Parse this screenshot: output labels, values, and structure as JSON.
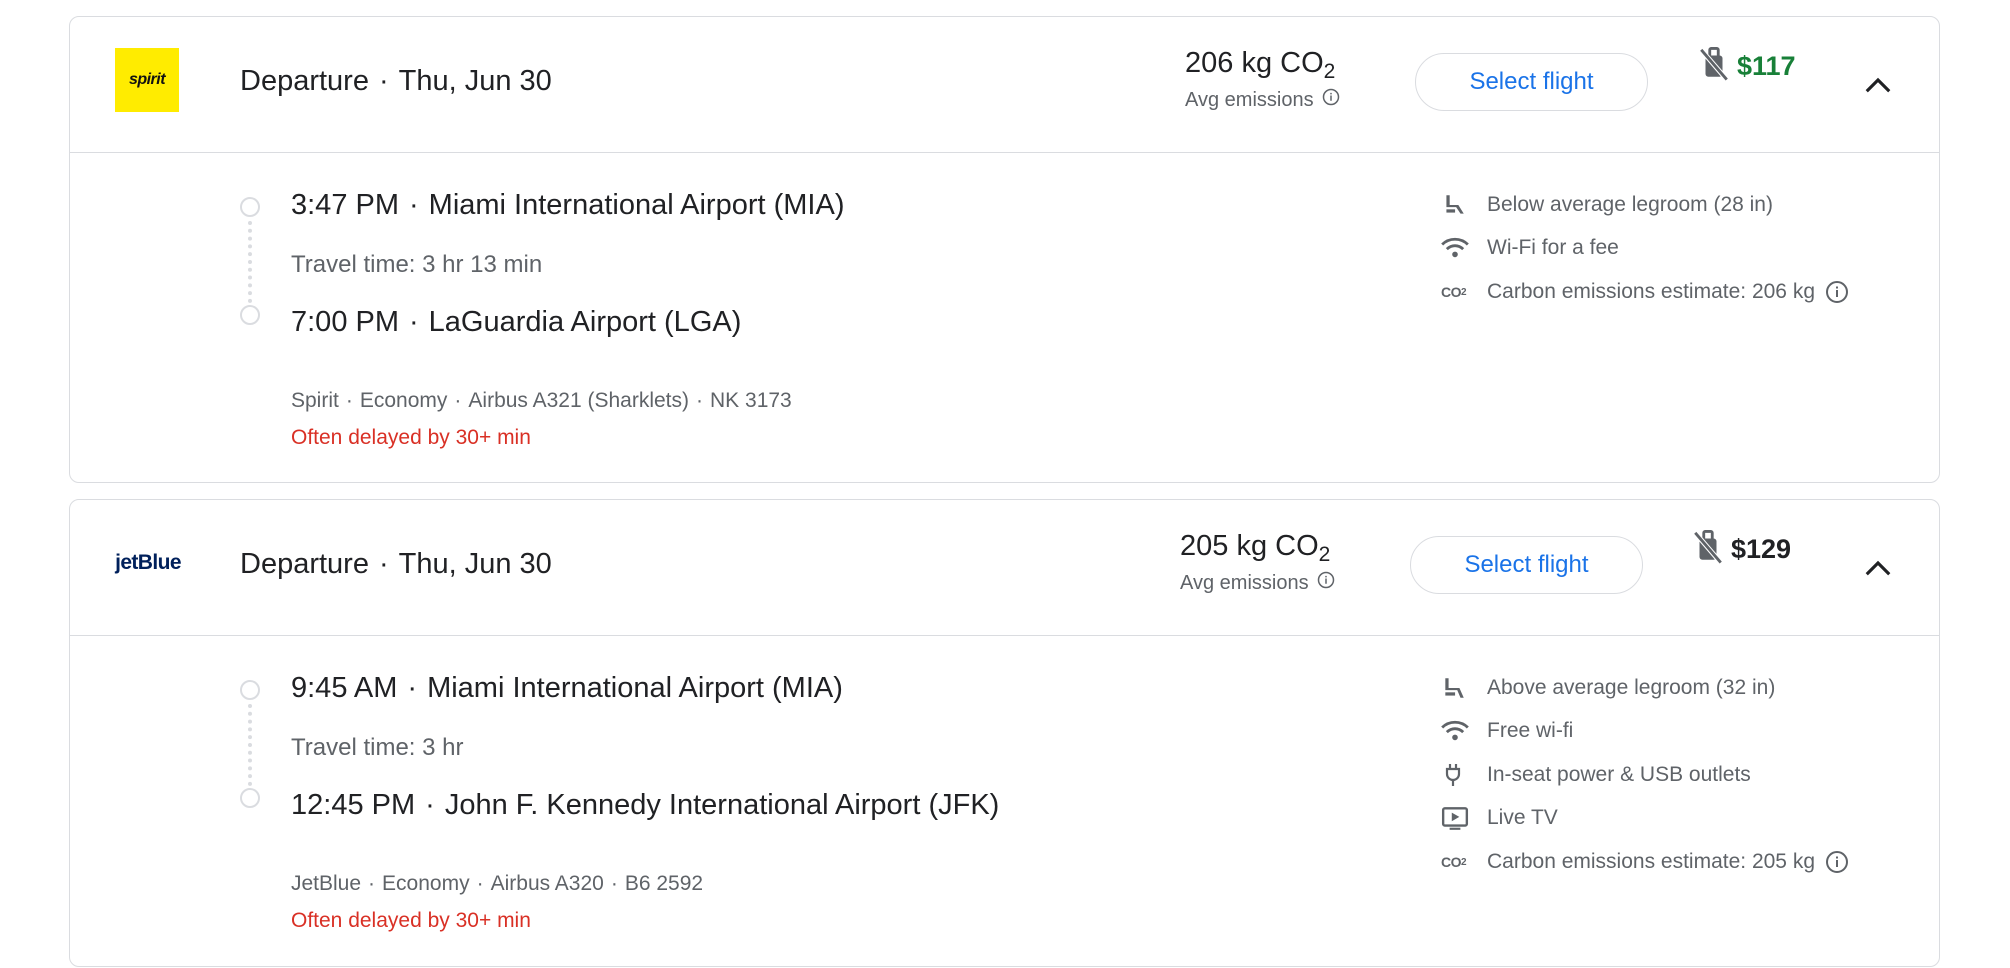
{
  "flights": [
    {
      "airline_logo": "spirit",
      "header": {
        "label": "Departure",
        "date": "Thu, Jun 30"
      },
      "emissions": {
        "value": "206 kg CO",
        "sub": "2",
        "label": "Avg emissions"
      },
      "select_label": "Select flight",
      "price": "$117",
      "price_color": "#188038",
      "departure": {
        "time": "3:47 PM",
        "airport": "Miami International Airport (MIA)"
      },
      "travel_time": "Travel time: 3 hr 13 min",
      "arrival": {
        "time": "7:00 PM",
        "airport": "LaGuardia Airport (LGA)"
      },
      "info": {
        "airline": "Spirit",
        "cabin": "Economy",
        "aircraft": "Airbus A321 (Sharklets)",
        "flight_no": "NK 3173"
      },
      "delay": "Often delayed by 30+ min",
      "amenities": [
        {
          "icon": "legroom-below-icon",
          "text": "Below average legroom (28 in)"
        },
        {
          "icon": "wifi-icon",
          "text": "Wi-Fi for a fee"
        },
        {
          "icon": "co2-icon",
          "text": "Carbon emissions estimate: 206 kg"
        }
      ]
    },
    {
      "airline_logo": "jetBlue",
      "header": {
        "label": "Departure",
        "date": "Thu, Jun 30"
      },
      "emissions": {
        "value": "205 kg CO",
        "sub": "2",
        "label": "Avg emissions"
      },
      "select_label": "Select flight",
      "price": "$129",
      "price_color": "#202124",
      "departure": {
        "time": "9:45 AM",
        "airport": "Miami International Airport (MIA)"
      },
      "travel_time": "Travel time: 3 hr",
      "arrival": {
        "time": "12:45 PM",
        "airport": "John F. Kennedy International Airport (JFK)"
      },
      "info": {
        "airline": "JetBlue",
        "cabin": "Economy",
        "aircraft": "Airbus A320",
        "flight_no": "B6 2592"
      },
      "delay": "Often delayed by 30+ min",
      "amenities": [
        {
          "icon": "legroom-above-icon",
          "text": "Above average legroom (32 in)"
        },
        {
          "icon": "wifi-icon",
          "text": "Free wi-fi"
        },
        {
          "icon": "power-plug-icon",
          "text": "In-seat power & USB outlets"
        },
        {
          "icon": "live-tv-icon",
          "text": "Live TV"
        },
        {
          "icon": "co2-icon",
          "text": "Carbon emissions estimate: 205 kg"
        }
      ]
    }
  ],
  "co2_icon_text": "CO",
  "co2_icon_sub": "2",
  "dot": "·"
}
